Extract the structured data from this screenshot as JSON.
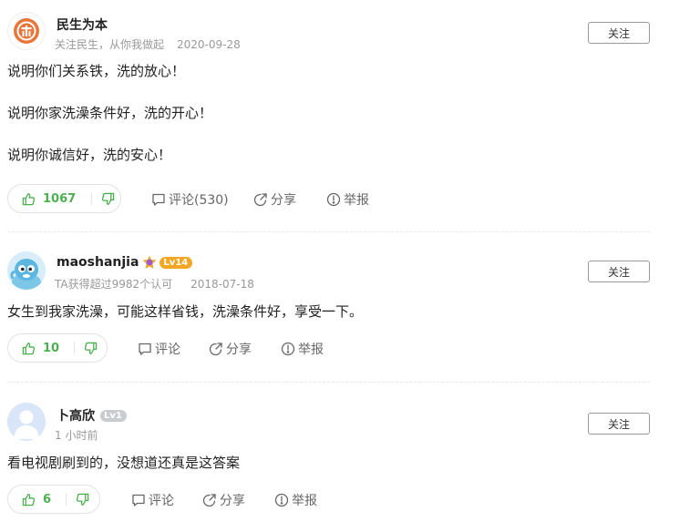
{
  "answers": [
    {
      "user": {
        "name": "民生为本",
        "subtitle": "关注民生，从你我做起",
        "date": "2020-09-28"
      },
      "follow_label": "关注",
      "paragraphs": [
        "说明你们关系铁，洗的放心！",
        "说明你家洗澡条件好，洗的开心！",
        "说明你诚信好，洗的安心！"
      ],
      "votes": {
        "up": "1067"
      },
      "actions": {
        "comment": "评论(530)",
        "share": "分享",
        "report": "举报"
      }
    },
    {
      "user": {
        "name": "maoshanjia",
        "level": "Lv14",
        "subtitle": "TA获得超过9982个认可",
        "date": "2018-07-18"
      },
      "follow_label": "关注",
      "paragraphs": [
        "女生到我家洗澡，可能这样省钱，洗澡条件好，享受一下。"
      ],
      "votes": {
        "up": "10"
      },
      "actions": {
        "comment": "评论",
        "share": "分享",
        "report": "举报"
      }
    },
    {
      "user": {
        "name": "卜高欣",
        "level": "Lv1",
        "subtitle": "1 小时前"
      },
      "follow_label": "关注",
      "paragraphs": [
        "看电视剧刷到的，没想道还真是这答案"
      ],
      "votes": {
        "up": "6"
      },
      "actions": {
        "comment": "评论",
        "share": "分享",
        "report": "举报"
      }
    }
  ],
  "colors": {
    "vote_green": "#4caf50",
    "level_orange": "#f5a623",
    "level_gray": "#c8ccd1",
    "text_gray": "#999999"
  }
}
